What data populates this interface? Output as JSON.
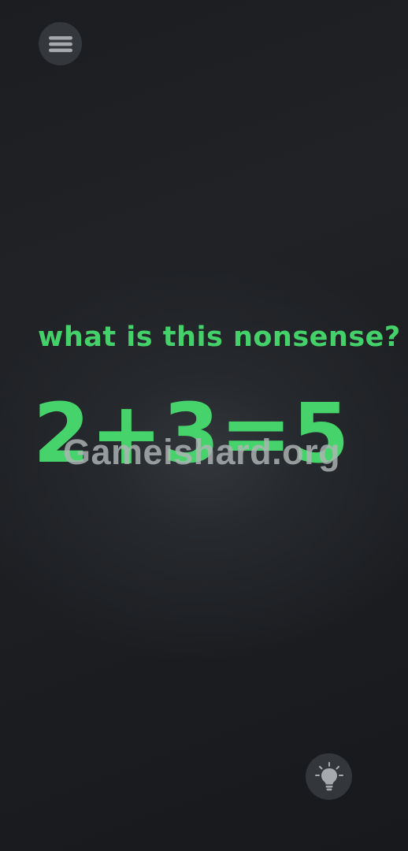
{
  "toolbar": {
    "menu_icon": "hamburger-menu-icon",
    "hint_icon": "lightbulb-icon"
  },
  "puzzle": {
    "question": "what is this nonsense?",
    "equation": [
      "2",
      "+",
      "3",
      "=",
      "5"
    ]
  },
  "watermark": {
    "text": "Gameishard.org"
  },
  "colors": {
    "accent_green": "#47d36c",
    "background": "#1c1e22",
    "button_bg": "#34373c",
    "icon_gray": "#a7a9ac"
  }
}
